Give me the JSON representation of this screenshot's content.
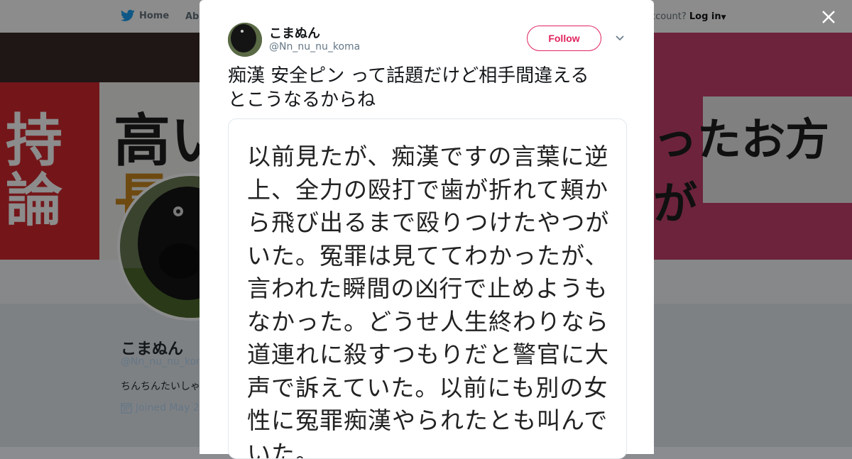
{
  "nav": {
    "home_label": "Home",
    "about_label_partial": "Abo",
    "account_prompt_partial": "ccount?",
    "login_label": "Log in"
  },
  "profile": {
    "name": "こまぬん",
    "handle_partial": "@Nn_nu_nu_kom",
    "bio_partial": "ちんちんたいしゃ",
    "joined_partial": "Joined May 20"
  },
  "banner": {
    "left_chars": [
      "持",
      "論"
    ],
    "middle_chars": [
      "高い",
      "長"
    ],
    "right_text": "ったお方が"
  },
  "tweet": {
    "author_name": "こまぬん",
    "author_handle": "@Nn_nu_nu_koma",
    "follow_label": "Follow",
    "text_line1": "痴漢 安全ピン って話題だけど相手間違える",
    "text_line2": "とこうなるからね",
    "media_lines": [
      "以前見たが、痴漢ですの言葉に逆",
      "上、全力の殴打で歯が折れて頬か",
      "ら飛び出るまで殴りつけたやつが",
      "いた。冤罪は見ててわかったが、",
      "言われた瞬間の凶行で止めようも",
      "なかった。どうせ人生終わりなら",
      "道連れに殺すつもりだと警官に大",
      "声で訴えていた。以前にも別の女",
      "性に冤罪痴漢やられたとも叫んで",
      "いた。"
    ]
  },
  "colors": {
    "twitter_blue": "#1da1f2",
    "follow_red": "#e0245e",
    "text_dark": "#14171a",
    "text_muted": "#657786"
  }
}
